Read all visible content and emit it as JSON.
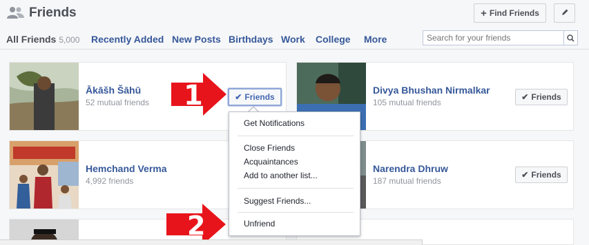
{
  "header": {
    "title": "Friends",
    "find_friends_label": "Find Friends"
  },
  "tabs": [
    {
      "label": "All Friends",
      "count": "5,000"
    },
    {
      "label": "Recently Added"
    },
    {
      "label": "New Posts"
    },
    {
      "label": "Birthdays"
    },
    {
      "label": "Work"
    },
    {
      "label": "College"
    },
    {
      "label": "More"
    }
  ],
  "search": {
    "placeholder": "Search for your friends"
  },
  "friends": [
    {
      "name": "Ākāšh Šāhū",
      "sub": "52 mutual friends",
      "button": "Friends"
    },
    {
      "name": "Divya Bhushan Nirmalkar",
      "sub": "105 mutual friends",
      "button": "Friends"
    },
    {
      "name": "Hemchand Verma",
      "sub": "4,992 friends"
    },
    {
      "name": "Narendra Dhruw",
      "sub": "187 mutual friends",
      "button": "Friends"
    }
  ],
  "menu": {
    "items": [
      "Get Notifications",
      "Close Friends",
      "Acquaintances",
      "Add to another list...",
      "Suggest Friends...",
      "Unfriend"
    ]
  },
  "annotations": {
    "step1": "1",
    "step2": "2"
  },
  "colors": {
    "link": "#365899",
    "arrow": "#e8141c"
  },
  "icons": [
    "friends-icon",
    "plus-icon",
    "pencil-icon",
    "search-icon",
    "check-icon"
  ]
}
